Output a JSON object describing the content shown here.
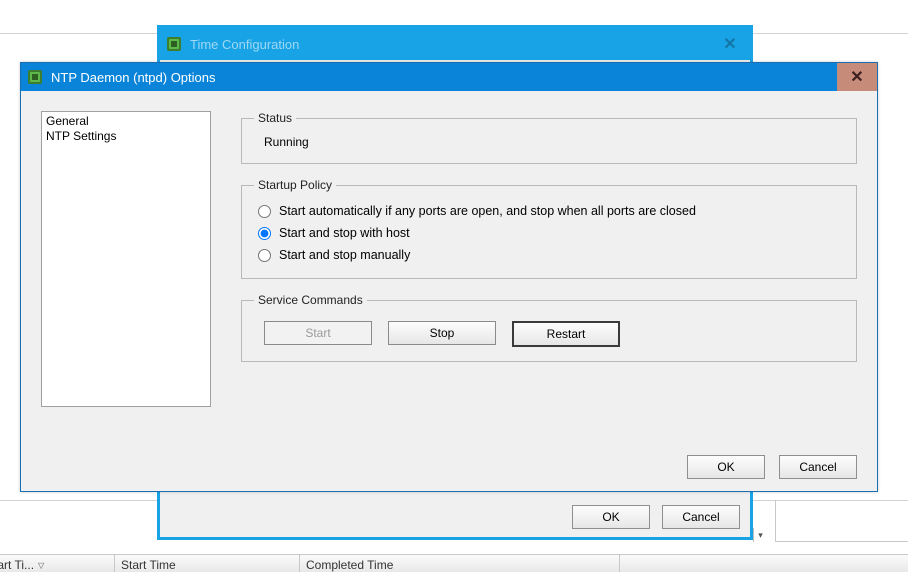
{
  "parent_window": {
    "title": "Time Configuration",
    "close_glyph": "✕",
    "buttons": {
      "ok": "OK",
      "cancel": "Cancel"
    }
  },
  "child_window": {
    "title": "NTP Daemon (ntpd) Options",
    "close_glyph": "✕",
    "nav": {
      "items": [
        "General",
        "NTP Settings"
      ]
    },
    "status": {
      "legend": "Status",
      "value": "Running"
    },
    "startup_policy": {
      "legend": "Startup Policy",
      "options": [
        "Start automatically if any ports are open, and stop when all ports are closed",
        "Start and stop with host",
        "Start and stop manually"
      ],
      "selected_index": 1
    },
    "service_commands": {
      "legend": "Service Commands",
      "start": "Start",
      "stop": "Stop",
      "restart": "Restart"
    },
    "buttons": {
      "ok": "OK",
      "cancel": "Cancel"
    }
  },
  "columns": {
    "c0": "ted Start Ti...",
    "c1": "Start Time",
    "c2": "Completed Time",
    "sort_glyph": "▽"
  }
}
